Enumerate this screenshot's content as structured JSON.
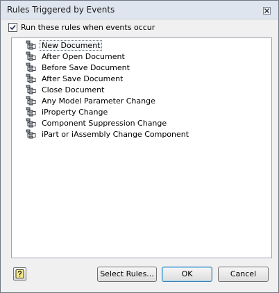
{
  "window": {
    "title": "Rules Triggered by Events",
    "close_icon": "close-icon"
  },
  "options": {
    "run_rules_label": "Run these rules when events occur",
    "run_rules_checked": true
  },
  "events": [
    {
      "label": "New Document",
      "icon": "rule-tree-icon",
      "selected": true
    },
    {
      "label": "After Open Document",
      "icon": "rule-tree-icon",
      "selected": false
    },
    {
      "label": "Before Save Document",
      "icon": "rule-tree-icon",
      "selected": false
    },
    {
      "label": "After Save Document",
      "icon": "rule-tree-icon",
      "selected": false
    },
    {
      "label": "Close Document",
      "icon": "rule-tree-icon",
      "selected": false
    },
    {
      "label": "Any Model Parameter Change",
      "icon": "rule-tree-icon",
      "selected": false
    },
    {
      "label": "iProperty Change",
      "icon": "rule-tree-icon",
      "selected": false
    },
    {
      "label": "Component Suppression Change",
      "icon": "rule-tree-icon",
      "selected": false
    },
    {
      "label": "iPart or iAssembly Change Component",
      "icon": "rule-tree-icon",
      "selected": false
    }
  ],
  "footer": {
    "help_icon": "help-icon",
    "select_rules_label": "Select Rules...",
    "ok_label": "OK",
    "cancel_label": "Cancel"
  }
}
